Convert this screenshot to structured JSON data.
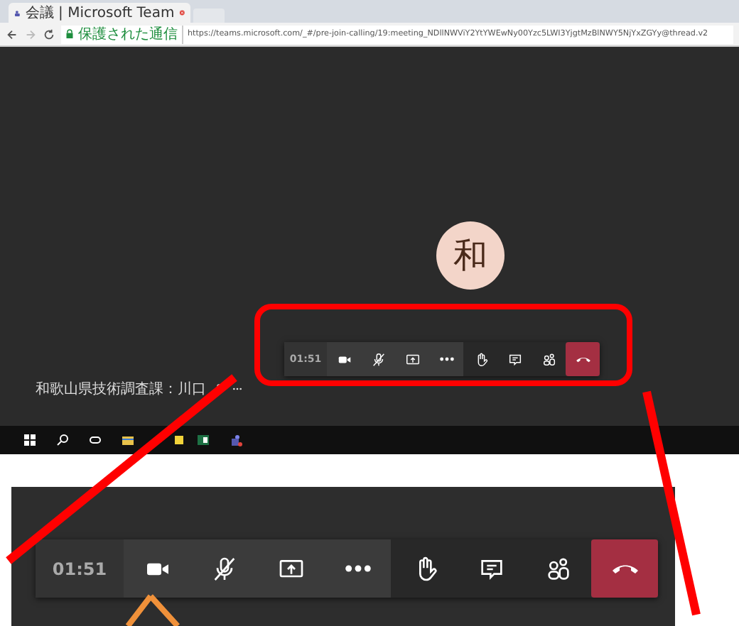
{
  "browser": {
    "tab_title": "会議 | Microsoft Team",
    "security_label": "保護された通信",
    "url": "https://teams.microsoft.com/_#/pre-join-calling/19:meeting_NDllNWViY2YtYWEwNy00Yzc5LWI3YjgtMzBlNWY5NjYxZGYy@thread.v2"
  },
  "meeting": {
    "avatar_initial": "和",
    "participant_name": "和歌山県技術調査課：川口",
    "toolbar": [
      {
        "kind": "timer",
        "text": "01:51"
      },
      {
        "kind": "camera"
      },
      {
        "kind": "mic-off"
      },
      {
        "kind": "share"
      },
      {
        "kind": "more"
      },
      {
        "kind": "hand"
      },
      {
        "kind": "chat"
      },
      {
        "kind": "people"
      },
      {
        "kind": "hangup"
      }
    ]
  },
  "zoomed_toolbar": [
    {
      "kind": "timer",
      "text": "01:51"
    },
    {
      "kind": "camera"
    },
    {
      "kind": "mic-off"
    },
    {
      "kind": "share"
    },
    {
      "kind": "more"
    },
    {
      "kind": "hand"
    },
    {
      "kind": "chat"
    },
    {
      "kind": "people"
    },
    {
      "kind": "hangup"
    }
  ]
}
